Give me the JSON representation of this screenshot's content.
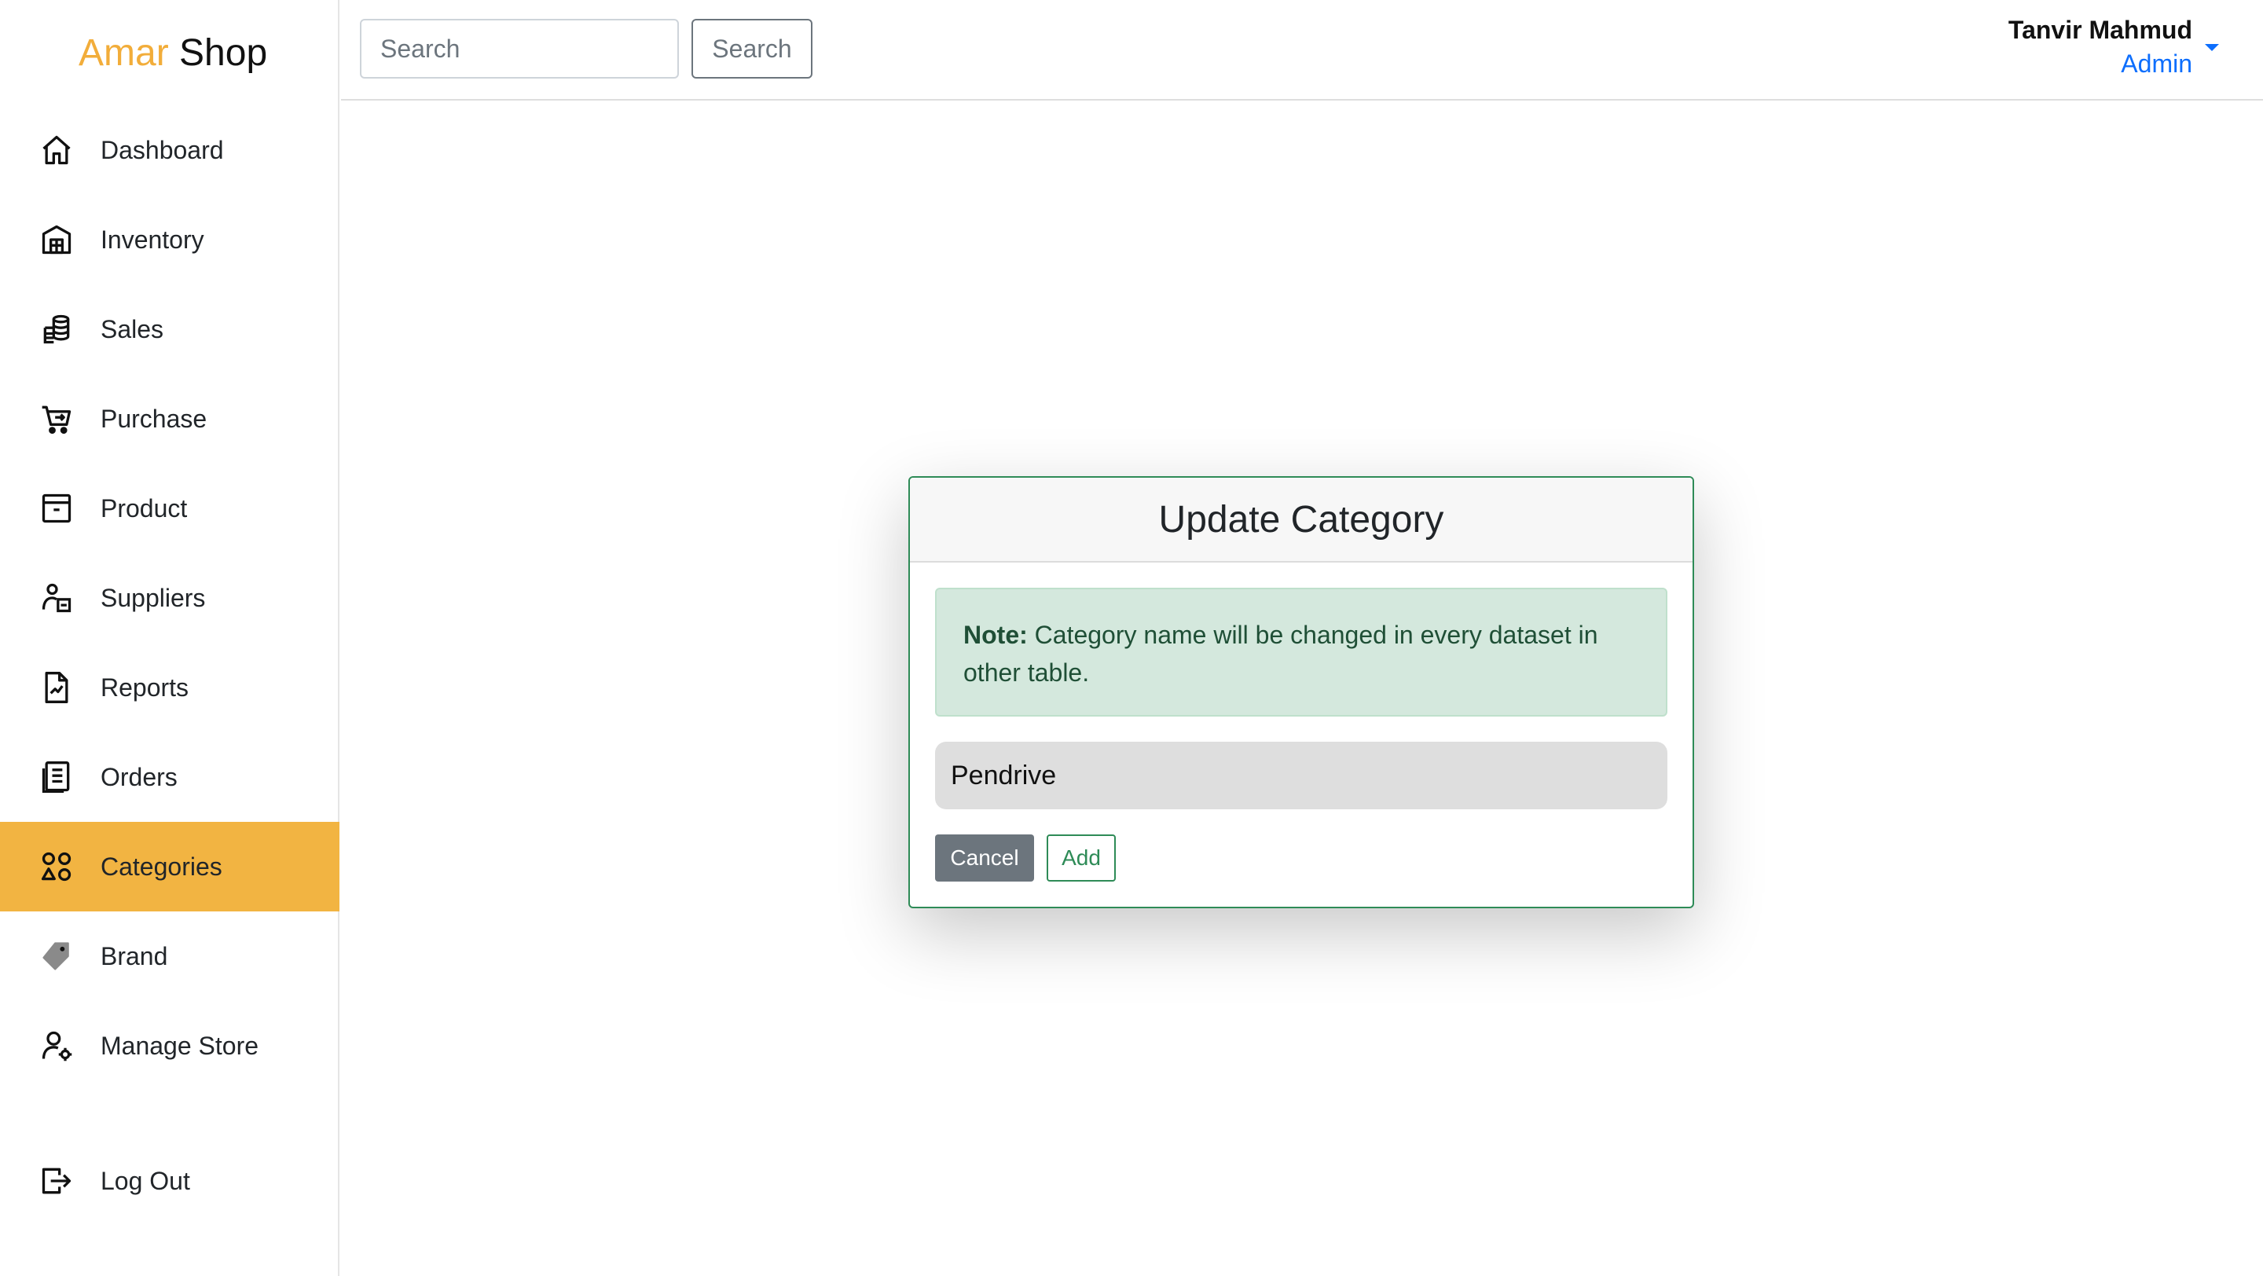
{
  "app": {
    "logo_part1": "Amar",
    "logo_part2": "Shop"
  },
  "sidebar": {
    "items": [
      {
        "label": "Dashboard",
        "icon": "home-icon"
      },
      {
        "label": "Inventory",
        "icon": "warehouse-icon"
      },
      {
        "label": "Sales",
        "icon": "coins-icon"
      },
      {
        "label": "Purchase",
        "icon": "cart-icon"
      },
      {
        "label": "Product",
        "icon": "archive-box-icon"
      },
      {
        "label": "Suppliers",
        "icon": "supplier-icon"
      },
      {
        "label": "Reports",
        "icon": "report-icon"
      },
      {
        "label": "Orders",
        "icon": "orders-icon"
      },
      {
        "label": "Categories",
        "icon": "categories-icon",
        "active": true
      },
      {
        "label": "Brand",
        "icon": "tag-icon"
      },
      {
        "label": "Manage Store",
        "icon": "user-gear-icon"
      }
    ],
    "logout_label": "Log Out"
  },
  "header": {
    "search_placeholder": "Search",
    "search_button": "Search",
    "user_name": "Tanvir Mahmud",
    "user_role": "Admin"
  },
  "modal": {
    "title": "Update Category",
    "note_label": "Note:",
    "note_text": " Category name will be changed in every dataset in other table.",
    "input_value": "Pendrive",
    "cancel_label": "Cancel",
    "add_label": "Add"
  },
  "colors": {
    "accent": "#f2b442",
    "logo_accent": "#f2ad3a",
    "success": "#2e8b57",
    "link": "#0d6efd"
  }
}
